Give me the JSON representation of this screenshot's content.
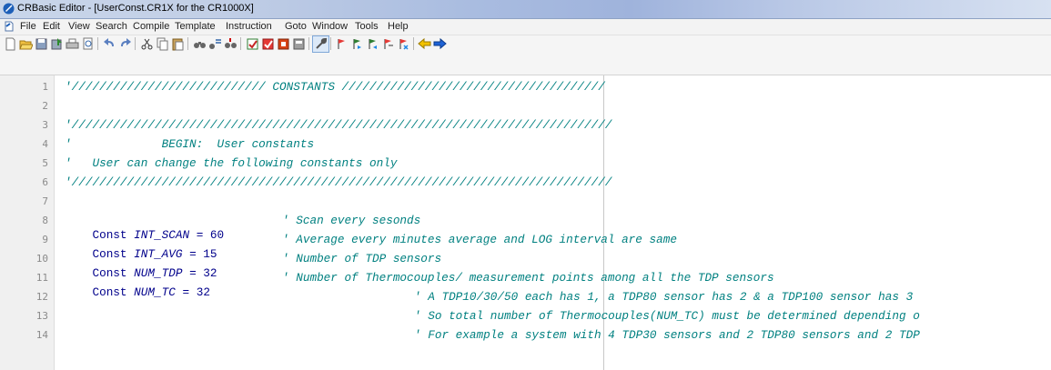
{
  "window": {
    "title": "CRBasic Editor - [UserConst.CR1X for the CR1000X]"
  },
  "menu": [
    "File",
    "Edit",
    "View",
    "Search",
    "Compile",
    "Template",
    "Instruction",
    "Goto",
    "Window",
    "Tools",
    "Help"
  ],
  "toolbar": {
    "icons": [
      "new-file-icon",
      "open-folder-icon",
      "save-icon",
      "save-compile-icon",
      "print-icon",
      "print-preview-icon",
      "undo-icon",
      "redo-icon",
      "cut-icon",
      "copy-icon",
      "paste-icon",
      "find-icon",
      "find-replace-icon",
      "find-next-icon",
      "compile-icon",
      "compile-save-icon",
      "send-program-icon",
      "program-settings-icon",
      "wrench-icon",
      "bookmark-icon",
      "bookmark-next-icon",
      "bookmark-prev-icon",
      "bookmark-toggle-icon",
      "bookmark-clear-icon",
      "goto-back-icon",
      "goto-forward-icon"
    ]
  },
  "editor": {
    "line_numbers": [
      "1",
      "2",
      "3",
      "4",
      "5",
      "6",
      "7",
      "8",
      "9",
      "10",
      "11",
      "12",
      "13",
      "14"
    ],
    "lines": {
      "l1": "'//////////////////////////// CONSTANTS //////////////////////////////////////",
      "l2": "",
      "l3": "'//////////////////////////////////////////////////////////////////////////////",
      "l4": "'             BEGIN:  User constants",
      "l5": "'   User can change the following constants only",
      "l6": "'//////////////////////////////////////////////////////////////////////////////",
      "l7": "",
      "l8_kw": "Const",
      "l8_id": "INT_SCAN",
      "l8_rest": " = 60",
      "l8_cmt": "' Scan every sesonds",
      "l9_kw": "Const",
      "l9_id": "INT_AVG",
      "l9_rest": " = 15",
      "l9_cmt": "' Average every minutes average and LOG interval are same",
      "l10_kw": "Const",
      "l10_id": "NUM_TDP",
      "l10_rest": " = 32",
      "l10_cmt": "' Number of TDP sensors",
      "l11_kw": "Const",
      "l11_id": "NUM_TC",
      "l11_rest": " = 32",
      "l11_cmt": "' Number of Thermocouples/ measurement points among all the TDP sensors",
      "l12_cmt": "' A TDP10/30/50 each has 1, a TDP80 sensor has 2 & a TDP100 sensor has 3",
      "l13_cmt": "' So total number of Thermocouples(NUM_TC) must be determined depending o",
      "l14_cmt": "' For example a system with 4 TDP30 sensors and 2 TDP80 sensors and 2 TDP"
    }
  }
}
